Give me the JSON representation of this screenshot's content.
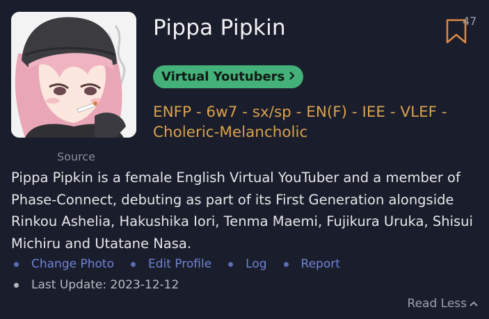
{
  "profile": {
    "name": "Pippa Pipkin",
    "source_label": "Source",
    "bookmark_count": "47",
    "category": "Virtual Youtubers",
    "typology": "ENFP - 6w7 - sx/sp - EN(F) - IEE - VLEF - Choleric-Melancholic",
    "description": "Pippa Pipkin is a female English Virtual YouTuber and a member of Phase-Connect, debuting as part of its First Generation alongside Rinkou Ashelia, Hakushika Iori, Tenma Maemi, Fujikura Uruka, Shisui Michiru and Utatane Nasa."
  },
  "actions": [
    {
      "label": "Change Photo"
    },
    {
      "label": "Edit Profile"
    },
    {
      "label": "Log"
    },
    {
      "label": "Report"
    }
  ],
  "last_update": "Last Update: 2023-12-12",
  "read_less_label": "Read Less",
  "colors": {
    "background": "#1a1d2b",
    "accent_orange": "#d9a24e",
    "pill_green": "#44b07a",
    "link_blue": "#6f85d8"
  },
  "icons": {
    "bookmark": "bookmark-icon",
    "pill_chevron": "chevron-right-icon",
    "read_less": "chevron-up-icon"
  }
}
